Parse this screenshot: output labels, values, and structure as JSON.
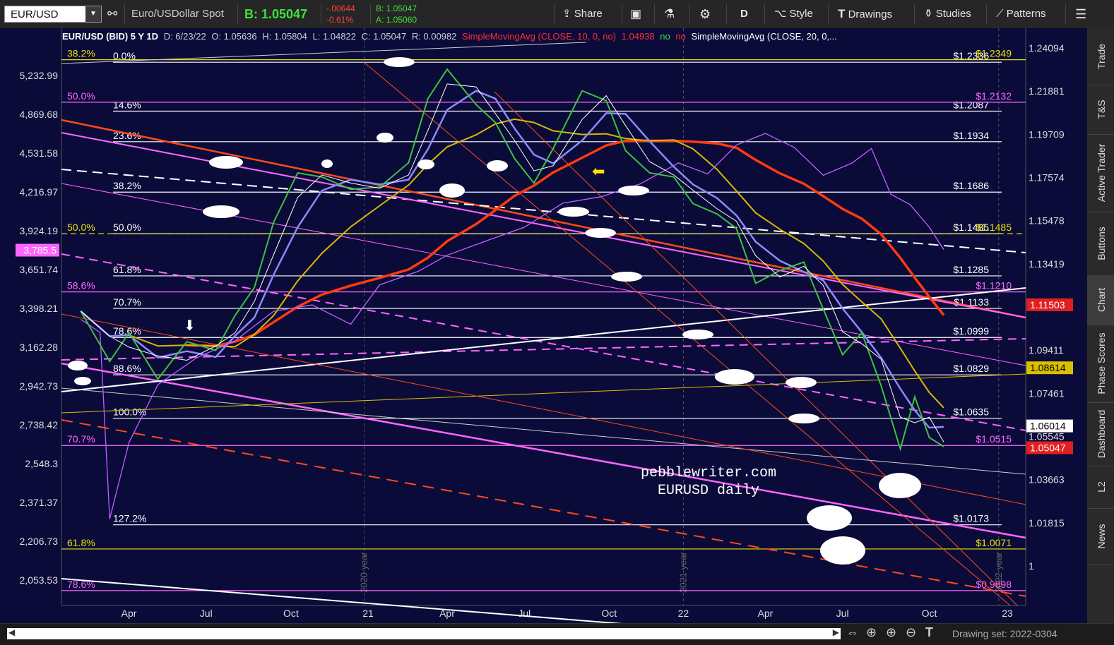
{
  "toolbar": {
    "symbol": "EUR/USD",
    "description": "Euro/USDollar Spot",
    "bid": "B: 1.05047",
    "change": "-.00644",
    "change_pct": "-0.61%",
    "bid_small": "B: 1.05047",
    "ask_small": "A: 1.05060",
    "share": "Share",
    "period": "D",
    "style": "Style",
    "drawings": "Drawings",
    "studies": "Studies",
    "patterns": "Patterns"
  },
  "infobar": {
    "title": "EUR/USD (BID) 5 Y 1D",
    "date": "D: 6/23/22",
    "open": "O: 1.05636",
    "high": "H: 1.05804",
    "low": "L: 1.04822",
    "close": "C: 1.05047",
    "range": "R: 0.00982",
    "sma10": "SimpleMovingAvg (CLOSE, 10, 0, no)",
    "sma10_val": "1.04938",
    "no1": "no",
    "no2": "no",
    "sma20": "SimpleMovingAvg (CLOSE, 20, 0,..."
  },
  "side_tabs": [
    "Trade",
    "T&S",
    "Active Trader",
    "Buttons",
    "Chart",
    "Phase Scores",
    "Dashboard",
    "L2",
    "News"
  ],
  "bottom": {
    "drawing_set": "Drawing set: 2022-0304"
  },
  "watermark": {
    "line1": "pebblewriter.com",
    "line2": "EURUSD daily"
  },
  "chart_data": {
    "type": "line",
    "title": "EUR/USD (BID) 5 Y 1D",
    "x_ticks": [
      "Apr",
      "Jul",
      "Oct",
      "21",
      "Apr",
      "Jul",
      "Oct",
      "22",
      "Apr",
      "Jul",
      "Oct",
      "23"
    ],
    "year_markers": [
      "2020 year",
      "2021 year",
      "2022 year"
    ],
    "y_right_ticks": [
      "1.24094",
      "1.21881",
      "1.19709",
      "1.17574",
      "1.15478",
      "1.13419",
      "1.09411",
      "1.07461",
      "1.05545",
      "1.03663",
      "1.01815",
      "1"
    ],
    "y_left_ticks": [
      "5,232.99",
      "4,869.68",
      "4,531.58",
      "4,216.97",
      "3,924.19",
      "3,651.74",
      "3,398.21",
      "3,162.28",
      "2,942.73",
      "2,738.42",
      "2,548.3",
      "2,371.37",
      "2,206.73",
      "2,053.53"
    ],
    "ylim": [
      0.985,
      1.25
    ],
    "left_ylim": [
      1960,
      5700
    ],
    "price_badges": [
      {
        "label": "1.11503",
        "value": 1.115,
        "color": "#e02020"
      },
      {
        "label": "1.08614",
        "value": 1.0861,
        "color": "#d8c000"
      },
      {
        "label": "1.06014",
        "value": 1.0601,
        "color": "#ffffff"
      },
      {
        "label": "1.05047",
        "value": 1.0505,
        "color": "#e02020"
      }
    ],
    "left_badge": {
      "label": "3,785.5",
      "value": 3785.5
    },
    "fib_levels": [
      {
        "pct": "0.0%",
        "label": "$1.2336",
        "value": 1.2336
      },
      {
        "pct": "14.6%",
        "label": "$1.2087",
        "value": 1.2087
      },
      {
        "pct": "23.6%",
        "label": "$1.1934",
        "value": 1.1934
      },
      {
        "pct": "38.2%",
        "label": "$1.1686",
        "value": 1.1686
      },
      {
        "pct": "50.0%",
        "label": "$1.1485",
        "value": 1.1485
      },
      {
        "pct": "61.8%",
        "label": "$1.1285",
        "value": 1.1285
      },
      {
        "pct": "70.7%",
        "label": "$1.1133",
        "value": 1.1133
      },
      {
        "pct": "78.6%",
        "label": "$1.0999",
        "value": 1.0999
      },
      {
        "pct": "88.6%",
        "label": "$1.0829",
        "value": 1.0829
      },
      {
        "pct": "100.0%",
        "label": "$1.0635",
        "value": 1.0635
      },
      {
        "pct": "127.2%",
        "label": "$1.0173",
        "value": 1.0173
      }
    ],
    "outer_fibs": [
      {
        "pct": "38.2%",
        "label": "$1.2349",
        "value": 1.2349,
        "color": "#e8e000"
      },
      {
        "pct": "50.0%",
        "label": "$1.2132",
        "value": 1.2132,
        "color": "#ff66ff"
      },
      {
        "pct": "50.0%",
        "label": "$1.1485",
        "value": 1.1485,
        "color": "#e8e000"
      },
      {
        "pct": "58.6%",
        "label": "$1.1210",
        "value": 1.121,
        "color": "#ff66ff"
      },
      {
        "pct": "70.7%",
        "label": "$1.0515",
        "value": 1.0515,
        "color": "#ff66ff"
      },
      {
        "pct": "61.8%",
        "label": "$1.0071",
        "value": 1.0071,
        "color": "#e8e000"
      },
      {
        "pct": "78.6%",
        "label": "$0.9898",
        "value": 0.9898,
        "color": "#ff66ff"
      }
    ],
    "price_series": [
      {
        "t": 0.02,
        "v": 1.112
      },
      {
        "t": 0.05,
        "v": 1.089
      },
      {
        "t": 0.07,
        "v": 1.102
      },
      {
        "t": 0.1,
        "v": 1.081
      },
      {
        "t": 0.13,
        "v": 1.098
      },
      {
        "t": 0.16,
        "v": 1.094
      },
      {
        "t": 0.18,
        "v": 1.11
      },
      {
        "t": 0.2,
        "v": 1.123
      },
      {
        "t": 0.22,
        "v": 1.154
      },
      {
        "t": 0.245,
        "v": 1.178
      },
      {
        "t": 0.27,
        "v": 1.176
      },
      {
        "t": 0.3,
        "v": 1.17
      },
      {
        "t": 0.33,
        "v": 1.171
      },
      {
        "t": 0.36,
        "v": 1.183
      },
      {
        "t": 0.38,
        "v": 1.215
      },
      {
        "t": 0.4,
        "v": 1.23
      },
      {
        "t": 0.43,
        "v": 1.212
      },
      {
        "t": 0.45,
        "v": 1.203
      },
      {
        "t": 0.47,
        "v": 1.185
      },
      {
        "t": 0.49,
        "v": 1.173
      },
      {
        "t": 0.51,
        "v": 1.19
      },
      {
        "t": 0.54,
        "v": 1.219
      },
      {
        "t": 0.565,
        "v": 1.214
      },
      {
        "t": 0.585,
        "v": 1.189
      },
      {
        "t": 0.61,
        "v": 1.178
      },
      {
        "t": 0.635,
        "v": 1.176
      },
      {
        "t": 0.655,
        "v": 1.163
      },
      {
        "t": 0.68,
        "v": 1.158
      },
      {
        "t": 0.7,
        "v": 1.151
      },
      {
        "t": 0.72,
        "v": 1.125
      },
      {
        "t": 0.745,
        "v": 1.131
      },
      {
        "t": 0.77,
        "v": 1.135
      },
      {
        "t": 0.79,
        "v": 1.113
      },
      {
        "t": 0.81,
        "v": 1.092
      },
      {
        "t": 0.83,
        "v": 1.102
      },
      {
        "t": 0.85,
        "v": 1.078
      },
      {
        "t": 0.87,
        "v": 1.05
      },
      {
        "t": 0.885,
        "v": 1.073
      },
      {
        "t": 0.9,
        "v": 1.055
      },
      {
        "t": 0.915,
        "v": 1.051
      }
    ],
    "spx_series": [
      {
        "t": 0.02,
        "v": 3330
      },
      {
        "t": 0.04,
        "v": 3250
      },
      {
        "t": 0.05,
        "v": 2300
      },
      {
        "t": 0.07,
        "v": 2650
      },
      {
        "t": 0.1,
        "v": 2950
      },
      {
        "t": 0.14,
        "v": 3100
      },
      {
        "t": 0.18,
        "v": 3200
      },
      {
        "t": 0.22,
        "v": 3380
      },
      {
        "t": 0.26,
        "v": 3420
      },
      {
        "t": 0.3,
        "v": 3300
      },
      {
        "t": 0.33,
        "v": 3550
      },
      {
        "t": 0.37,
        "v": 3640
      },
      {
        "t": 0.4,
        "v": 3750
      },
      {
        "t": 0.44,
        "v": 3850
      },
      {
        "t": 0.48,
        "v": 3950
      },
      {
        "t": 0.52,
        "v": 4130
      },
      {
        "t": 0.56,
        "v": 4180
      },
      {
        "t": 0.6,
        "v": 4280
      },
      {
        "t": 0.64,
        "v": 4450
      },
      {
        "t": 0.67,
        "v": 4360
      },
      {
        "t": 0.7,
        "v": 4600
      },
      {
        "t": 0.73,
        "v": 4700
      },
      {
        "t": 0.76,
        "v": 4580
      },
      {
        "t": 0.79,
        "v": 4350
      },
      {
        "t": 0.82,
        "v": 4450
      },
      {
        "t": 0.84,
        "v": 4570
      },
      {
        "t": 0.86,
        "v": 4200
      },
      {
        "t": 0.88,
        "v": 4120
      },
      {
        "t": 0.9,
        "v": 3950
      },
      {
        "t": 0.915,
        "v": 3790
      }
    ]
  }
}
